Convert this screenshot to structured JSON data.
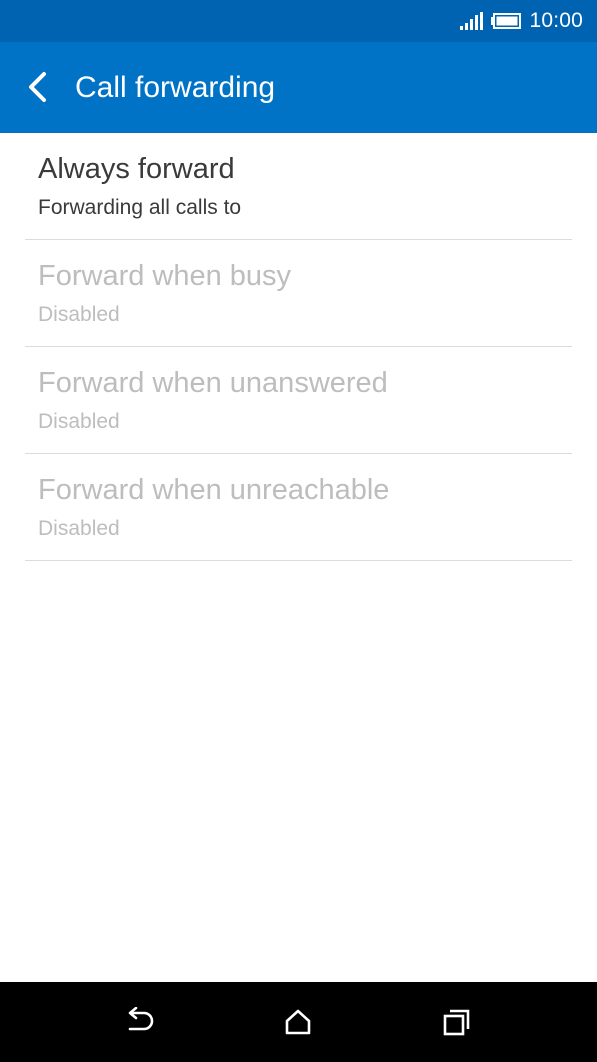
{
  "status_bar": {
    "time": "10:00",
    "icons": [
      "signal-icon",
      "battery-icon"
    ]
  },
  "app_bar": {
    "title": "Call forwarding",
    "back_icon": "chevron-left-icon"
  },
  "settings": {
    "items": [
      {
        "title": "Always forward",
        "summary": "Forwarding all calls to",
        "enabled": true
      },
      {
        "title": "Forward when busy",
        "summary": "Disabled",
        "enabled": false
      },
      {
        "title": "Forward when unanswered",
        "summary": "Disabled",
        "enabled": false
      },
      {
        "title": "Forward when unreachable",
        "summary": "Disabled",
        "enabled": false
      }
    ]
  },
  "nav_bar": {
    "icons": [
      "back-arrow-icon",
      "home-icon",
      "recents-icon"
    ]
  },
  "colors": {
    "status_bar": "#0063b1",
    "app_bar": "#0073c6",
    "text_primary": "#3a3a3a",
    "text_disabled": "#bdbdbd",
    "divider": "#dcdcdc",
    "nav_bar": "#000000"
  }
}
